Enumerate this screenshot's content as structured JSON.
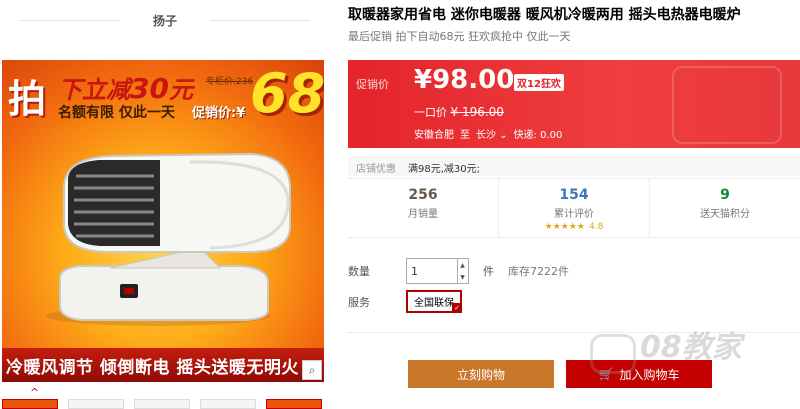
{
  "shop": {
    "name": "扬子"
  },
  "gallery": {
    "badge": "拍",
    "promo_line1_prefix": "下立减",
    "promo_line1_num": "30",
    "promo_line1_suffix": "元",
    "promo_line2": "名额有限 仅此一天",
    "special_price": "专柜价:236",
    "promo_price_label": "促销价:¥",
    "big_price": "68",
    "bottom_banner": "冷暖风调节 倾倒断电  摇头送暖无明火",
    "zoom_icon": "magnifier-icon",
    "thumb_up": "^",
    "colors": {
      "bg_center": "#ffd24d",
      "bg_edge": "#d8420a",
      "banner": "#c41e0d"
    }
  },
  "product": {
    "title": "取暖器家用省电 迷你电暖器 暖风机冷暖两用 摇头电热器电暖炉",
    "subtitle": "最后促销 拍下自动68元 狂欢疯抢中 仅此一天"
  },
  "price": {
    "label": "促销价",
    "current": "¥98.00",
    "tag": "双12狂欢",
    "orig_label": "一口价",
    "orig_value": "¥ 196.00",
    "ship_from": "安徽合肥",
    "ship_to_word": "至",
    "ship_dest": "长沙",
    "ship_fee": "快递: 0.00",
    "accent": "#e3242b"
  },
  "shop_promo": {
    "label": "店铺优惠",
    "value": "满98元,减30元;"
  },
  "stats": [
    {
      "num": "256",
      "label": "月销量"
    },
    {
      "num": "154",
      "label": "累计评价",
      "stars": "★★★★★",
      "score": "4.8"
    },
    {
      "num": "9",
      "label": "送天猫积分"
    }
  ],
  "quantity": {
    "label": "数量",
    "value": "1",
    "unit": "件",
    "stock": "库存7222件"
  },
  "service": {
    "label": "服务",
    "tag": "全国联保"
  },
  "actions": {
    "buy_now": "立刻购物",
    "add_cart": "加入购物车"
  },
  "watermark": {
    "text": "08教家"
  }
}
